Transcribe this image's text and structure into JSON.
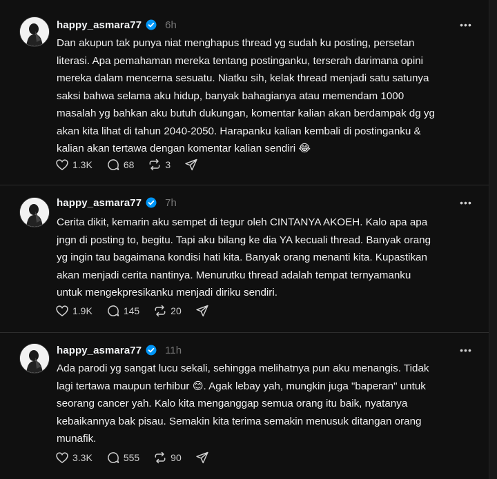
{
  "posts": [
    {
      "username": "happy_asmara77",
      "time": "6h",
      "text": "Dan akupun tak punya niat menghapus thread yg sudah ku posting, persetan\nliterasi. Apa pemahaman mereka tentang postinganku, terserah darimana opini\nmereka dalam mencerna sesuatu. Niatku sih, kelak thread menjadi satu satunya\nsaksi bahwa selama aku hidup, banyak bahagianya atau memendam 1000\nmasalah yg bahkan aku butuh dukungan, komentar kalian akan berdampak dg yg\nakan kita lihat di tahun 2040-2050. Harapanku kalian kembali di postinganku &\nkalian akan tertawa dengan komentar kalian sendiri 😂",
      "likes": "1.3K",
      "replies": "68",
      "reposts": "3"
    },
    {
      "username": "happy_asmara77",
      "time": "7h",
      "text": "Cerita dikit, kemarin aku sempet di tegur oleh CINTANYA AKOEH. Kalo apa apa\njngn di posting to, begitu. Tapi aku bilang ke dia YA kecuali thread. Banyak orang\nyg ingin tau bagaimana kondisi hati kita. Banyak orang menanti kita. Kupastikan\nakan menjadi cerita nantinya. Menurutku thread adalah tempat ternyamanku\nuntuk mengekpresikanku menjadi diriku sendiri.",
      "likes": "1.9K",
      "replies": "145",
      "reposts": "20"
    },
    {
      "username": "happy_asmara77",
      "time": "11h",
      "text": "Ada parodi yg sangat lucu sekali, sehingga melihatnya pun aku menangis. Tidak\nlagi tertawa maupun terhibur 😊. Agak lebay yah, mungkin juga \"baperan\" untuk\nseorang cancer yah. Kalo kita menganggap semua orang itu baik, nyatanya\nkebaikannya bak pisau. Semakin kita terima semakin menusuk ditangan orang\nmunafik.",
      "likes": "3.3K",
      "replies": "555",
      "reposts": "90"
    }
  ],
  "colors": {
    "background": "#101010",
    "verified": "#0095f6",
    "muted": "#777777"
  },
  "icons": [
    "heart-icon",
    "comment-icon",
    "repost-icon",
    "share-icon",
    "verified-icon",
    "more-icon"
  ]
}
